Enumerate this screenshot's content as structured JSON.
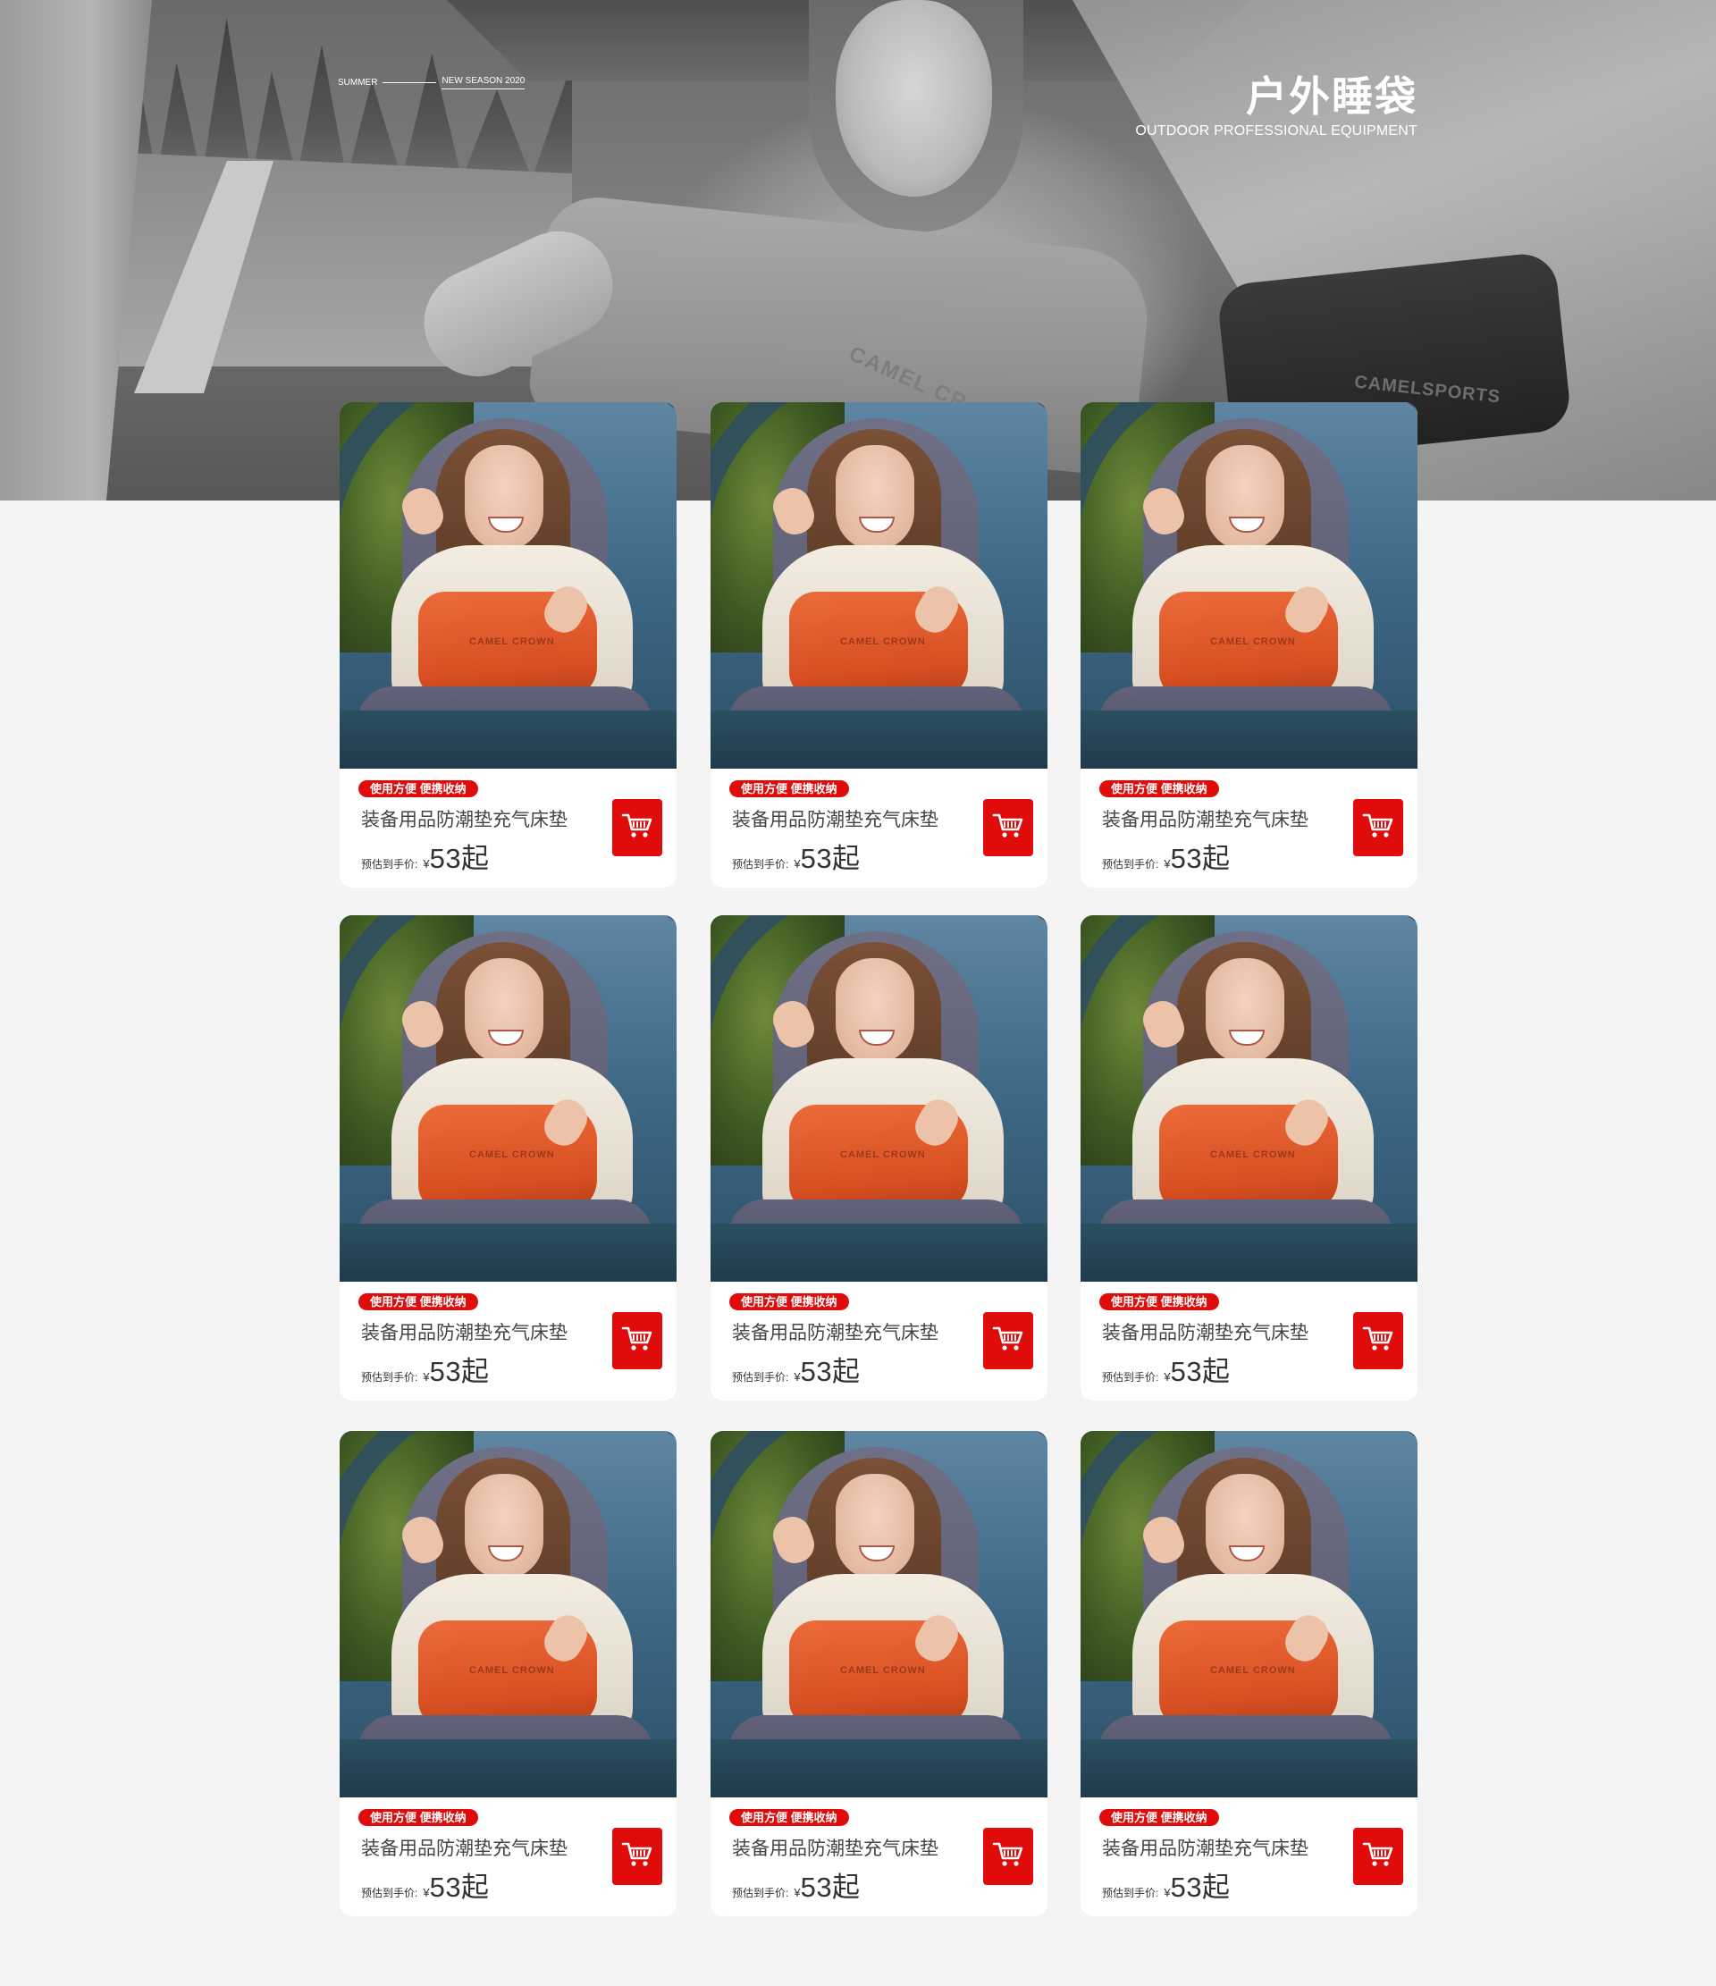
{
  "hero": {
    "tagline_left": "SUMMER",
    "tagline_right": "NEW SEASON 2020",
    "title": "户外睡袋",
    "subtitle": "OUTDOOR PROFESSIONAL EQUIPMENT",
    "brand_marks": [
      "CAMEL CR",
      "CAMELSPORTS"
    ]
  },
  "product_photo": {
    "bag_logo": "CAMEL CROWN"
  },
  "colors": {
    "accent_red": "#e00b0b",
    "page_bg": "#f4f4f4",
    "card_bg": "#ffffff"
  },
  "products": [
    {
      "tag": "使用方便 便携收纳",
      "name": "装备用品防潮垫充气床垫",
      "price_label": "预估到手价:",
      "currency": "¥",
      "price": "53起",
      "cart_icon": "shopping-cart-icon"
    },
    {
      "tag": "使用方便 便携收纳",
      "name": "装备用品防潮垫充气床垫",
      "price_label": "预估到手价:",
      "currency": "¥",
      "price": "53起",
      "cart_icon": "shopping-cart-icon"
    },
    {
      "tag": "使用方便 便携收纳",
      "name": "装备用品防潮垫充气床垫",
      "price_label": "预估到手价:",
      "currency": "¥",
      "price": "53起",
      "cart_icon": "shopping-cart-icon"
    },
    {
      "tag": "使用方便 便携收纳",
      "name": "装备用品防潮垫充气床垫",
      "price_label": "预估到手价:",
      "currency": "¥",
      "price": "53起",
      "cart_icon": "shopping-cart-icon"
    },
    {
      "tag": "使用方便 便携收纳",
      "name": "装备用品防潮垫充气床垫",
      "price_label": "预估到手价:",
      "currency": "¥",
      "price": "53起",
      "cart_icon": "shopping-cart-icon"
    },
    {
      "tag": "使用方便 便携收纳",
      "name": "装备用品防潮垫充气床垫",
      "price_label": "预估到手价:",
      "currency": "¥",
      "price": "53起",
      "cart_icon": "shopping-cart-icon"
    },
    {
      "tag": "使用方便 便携收纳",
      "name": "装备用品防潮垫充气床垫",
      "price_label": "预估到手价:",
      "currency": "¥",
      "price": "53起",
      "cart_icon": "shopping-cart-icon"
    },
    {
      "tag": "使用方便 便携收纳",
      "name": "装备用品防潮垫充气床垫",
      "price_label": "预估到手价:",
      "currency": "¥",
      "price": "53起",
      "cart_icon": "shopping-cart-icon"
    },
    {
      "tag": "使用方便 便携收纳",
      "name": "装备用品防潮垫充气床垫",
      "price_label": "预估到手价:",
      "currency": "¥",
      "price": "53起",
      "cart_icon": "shopping-cart-icon"
    }
  ]
}
